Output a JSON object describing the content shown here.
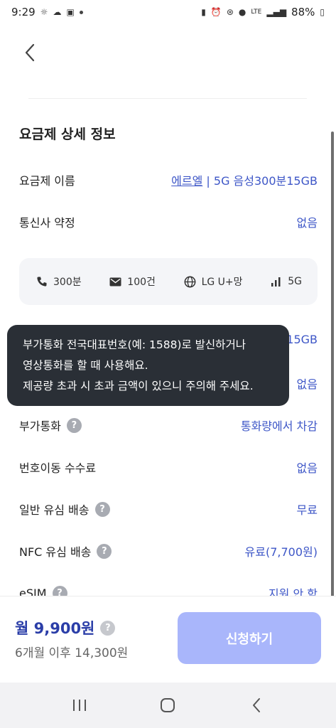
{
  "status_bar": {
    "time": "9:29",
    "battery": "88%",
    "network_label": "LTE"
  },
  "section_title": "요금제 상세 정보",
  "rows": [
    {
      "label": "요금제 이름",
      "value_link": "에르엘",
      "value_rest": " | 5G 음성300분15GB"
    },
    {
      "label": "통신사 약정",
      "value": "없음"
    }
  ],
  "spec_card": [
    {
      "icon": "phone-icon",
      "label": "300분"
    },
    {
      "icon": "mail-icon",
      "label": "100건"
    },
    {
      "icon": "globe-icon",
      "label": "LG U+망"
    },
    {
      "icon": "signal-icon",
      "label": "5G"
    }
  ],
  "hidden_rows": {
    "data_value_partial": "15GB",
    "sms_value_partial": "없음"
  },
  "tooltip": {
    "line1": "부가통화 전국대표번호(예: 1588)로 발신하거나",
    "line2": "영상통화를 할 때 사용해요.",
    "line3": "제공량 초과 시 초과 금액이 있으니 주의해 주세요."
  },
  "detail_rows": [
    {
      "label": "부가통화",
      "help": "?",
      "value": "통화량에서 차감"
    },
    {
      "label": "번호이동 수수료",
      "value": "없음"
    },
    {
      "label": "일반 유심 배송",
      "help": "?",
      "value": "무료"
    },
    {
      "label": "NFC 유심 배송",
      "help": "?",
      "value": "유료(7,700원)"
    },
    {
      "label": "eSIM",
      "help": "?",
      "value": "지원 안 함"
    }
  ],
  "price": {
    "main": "월 9,900원",
    "help": "?",
    "sub": "6개월 이후 14,300원"
  },
  "apply_button": "신청하기",
  "colors": {
    "accent": "#3d56c7",
    "button": "#a9b6fb",
    "tooltip_bg": "#2a2f36"
  }
}
